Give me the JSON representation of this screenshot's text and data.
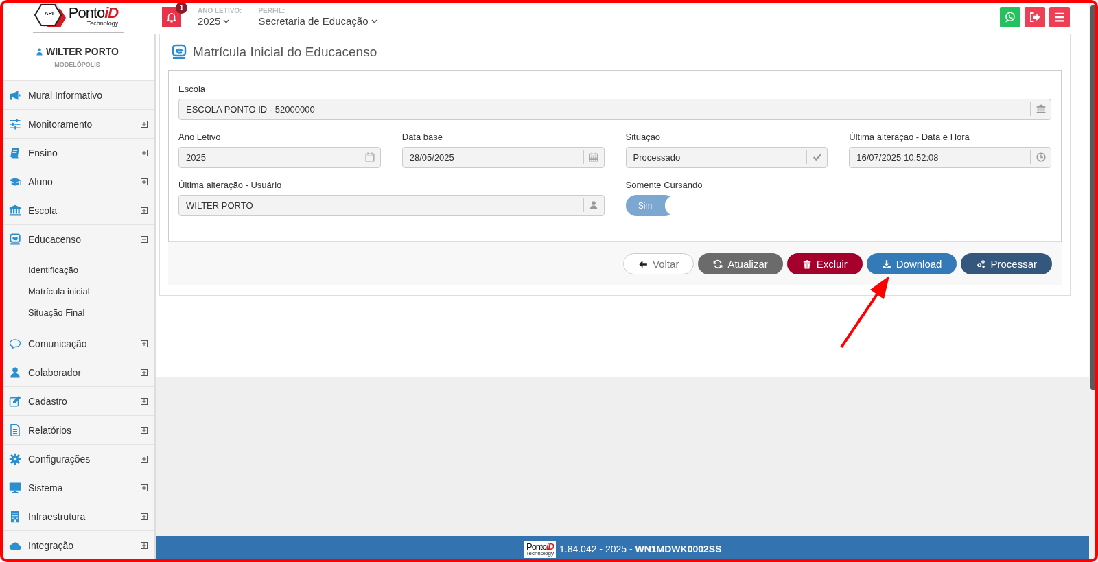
{
  "header": {
    "logo": {
      "badge": "API",
      "brand": "Ponto",
      "brand_accent": "iD",
      "tagline": "Technology"
    },
    "notifications": {
      "count": "1"
    },
    "selectors": [
      {
        "label": "ANO LETIVO:",
        "value": "2025"
      },
      {
        "label": "PERFIL:",
        "value": "Secretaria de Educação"
      }
    ],
    "actions": [
      {
        "kind": "whatsapp"
      },
      {
        "kind": "logout"
      },
      {
        "kind": "menu"
      }
    ]
  },
  "sidebar": {
    "user": {
      "name": "WILTER PORTO",
      "city": "MODELÓPOLIS"
    },
    "items": [
      {
        "label": "Mural Informativo"
      },
      {
        "label": "Monitoramento",
        "expanded": false
      },
      {
        "label": "Ensino",
        "expanded": false
      },
      {
        "label": "Aluno",
        "expanded": false
      },
      {
        "label": "Escola",
        "expanded": false
      },
      {
        "label": "Educacenso",
        "expanded": true,
        "children": [
          {
            "label": "Identificação"
          },
          {
            "label": "Matrícula inicial"
          },
          {
            "label": "Situação Final"
          }
        ]
      },
      {
        "label": "Comunicação",
        "expanded": false
      },
      {
        "label": "Colaborador",
        "expanded": false
      },
      {
        "label": "Cadastro",
        "expanded": false
      },
      {
        "label": "Relatórios",
        "expanded": false
      },
      {
        "label": "Configurações",
        "expanded": false
      },
      {
        "label": "Sistema",
        "expanded": false
      },
      {
        "label": "Infraestrutura",
        "expanded": false
      },
      {
        "label": "Integração",
        "expanded": false
      }
    ]
  },
  "page": {
    "title": "Matrícula Inicial do Educacenso",
    "rows": [
      [
        {
          "kind": "text",
          "label": "Escola",
          "value": "ESCOLA PONTO ID - 52000000"
        }
      ],
      [
        {
          "kind": "text",
          "label": "Ano Letivo",
          "value": "2025"
        },
        {
          "kind": "text",
          "label": "Data base",
          "value": "28/05/2025"
        },
        {
          "kind": "text",
          "label": "Situação",
          "value": "Processado"
        },
        {
          "kind": "text",
          "label": "Última alteração - Data e Hora",
          "value": "16/07/2025 10:52:08"
        }
      ],
      [
        {
          "kind": "text",
          "label": "Última alteração - Usuário",
          "value": "WILTER PORTO"
        },
        "",
        {
          "kind": "toggle",
          "label": "Somente Cursando",
          "on": true,
          "text": "Sim"
        }
      ]
    ],
    "buttons": [
      {
        "kind": "back",
        "label": "Voltar"
      },
      {
        "kind": "refresh",
        "label": "Atualizar"
      },
      {
        "kind": "delete",
        "label": "Excluir"
      },
      {
        "kind": "download",
        "label": "Download"
      },
      {
        "kind": "process",
        "label": "Processar"
      }
    ]
  },
  "footer": {
    "logo": {
      "brand": "Ponto",
      "brand_accent": "iD",
      "tagline": "Technology"
    },
    "text": "1.84.042 - 2025 **- WN1MDWK0002SS**"
  }
}
